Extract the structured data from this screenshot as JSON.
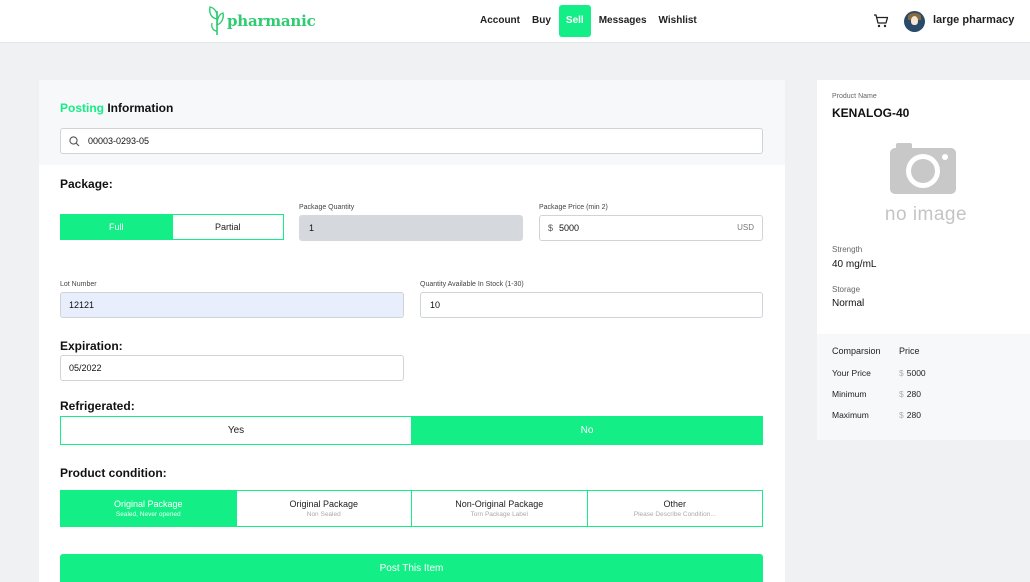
{
  "header": {
    "logo_text": "pharmanic",
    "nav": [
      {
        "label": "Account"
      },
      {
        "label": "Buy"
      },
      {
        "label": "Sell",
        "active": true
      },
      {
        "label": "Messages"
      },
      {
        "label": "Wishlist"
      }
    ],
    "username": "large pharmacy",
    "icons": {
      "cart": "cart-icon",
      "avatar": "avatar"
    }
  },
  "colors": {
    "accent": "#14ee86",
    "background": "#f0f1f3",
    "input_gray": "#d5d8dd",
    "input_blue": "#e8eefc"
  },
  "posting": {
    "title_green": "Posting",
    "title_rest": "Information",
    "search_value": "00003-0293-05"
  },
  "package": {
    "title": "Package:",
    "options": [
      {
        "label": "Full",
        "selected": true
      },
      {
        "label": "Partial",
        "selected": false
      }
    ],
    "quantity_label": "Package Quantity",
    "quantity_value": "1",
    "price_label": "Package Price (min 2)",
    "price_prefix": "$",
    "price_value": "5000",
    "price_suffix": "USD"
  },
  "lot": {
    "label": "Lot Number",
    "value": "12121",
    "stock_label": "Quantity Available In Stock (1-30)",
    "stock_value": "10"
  },
  "expiration": {
    "title": "Expiration:",
    "value": "05/2022"
  },
  "refrigerated": {
    "title": "Refrigerated:",
    "options": [
      {
        "label": "Yes",
        "selected": false
      },
      {
        "label": "No",
        "selected": true
      }
    ]
  },
  "condition": {
    "title": "Product condition:",
    "options": [
      {
        "label": "Original Package",
        "sub": "Sealed, Never opened",
        "selected": true
      },
      {
        "label": "Original Package",
        "sub": "Non Sealed",
        "selected": false
      },
      {
        "label": "Non-Original Package",
        "sub": "Torn Package Label",
        "selected": false
      },
      {
        "label": "Other",
        "sub": "Please Describe Condition...",
        "selected": false
      }
    ]
  },
  "post_button": "Post This Item",
  "product": {
    "name_label": "Product Name",
    "name": "KENALOG-40",
    "no_image": "no image",
    "strength_label": "Strength",
    "strength": "40 mg/mL",
    "storage_label": "Storage",
    "storage": "Normal"
  },
  "comparison": {
    "col1": "Comparsion",
    "col2": "Price",
    "rows": [
      {
        "label": "Your Price",
        "currency": "$",
        "value": "5000"
      },
      {
        "label": "Minimum",
        "currency": "$",
        "value": "280"
      },
      {
        "label": "Maximum",
        "currency": "$",
        "value": "280"
      }
    ]
  }
}
